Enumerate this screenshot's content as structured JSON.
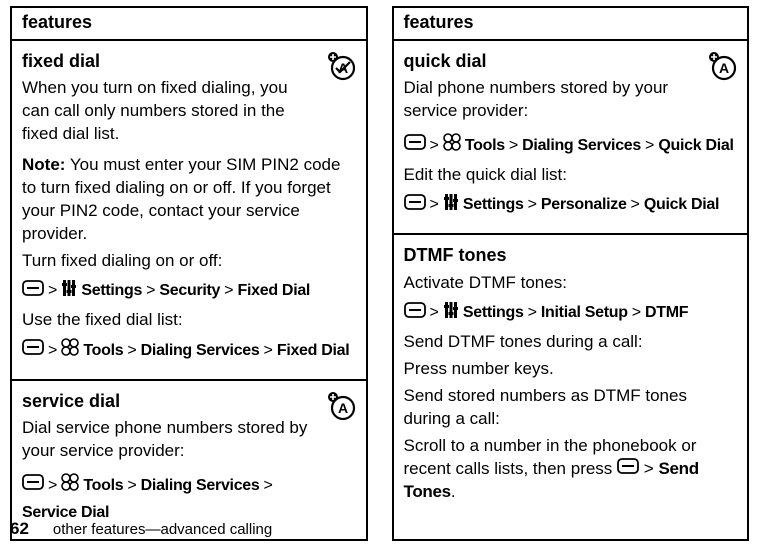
{
  "header": "features",
  "footer": {
    "page": "62",
    "text": "other features—advanced calling"
  },
  "left": {
    "fixed_dial": {
      "title": "fixed dial",
      "p1": "When you turn on fixed dialing, you can call only numbers stored in the fixed dial list.",
      "note_label": "Note:",
      "note_body": " You must enter your SIM PIN2 code to turn fixed dialing on or off. If you forget your PIN2 code, contact your service provider.",
      "p2": "Turn fixed dialing on or off:",
      "path1": {
        "a": "Settings",
        "b": "Security",
        "c": "Fixed Dial"
      },
      "p3": "Use the fixed dial list:",
      "path2": {
        "a": "Tools",
        "b": "Dialing Services",
        "c": "Fixed Dial"
      }
    },
    "service_dial": {
      "title": "service dial",
      "p1": "Dial service phone numbers stored by your service provider:",
      "path1": {
        "a": "Tools",
        "b": "Dialing Services",
        "c": "Service Dial"
      }
    }
  },
  "right": {
    "quick_dial": {
      "title": "quick dial",
      "p1": "Dial phone numbers stored by your service provider:",
      "path1": {
        "a": "Tools",
        "b": "Dialing Services",
        "c": "Quick Dial"
      },
      "p2": "Edit the quick dial list:",
      "path2": {
        "a": "Settings",
        "b": "Personalize",
        "c": "Quick Dial"
      }
    },
    "dtmf": {
      "title": "DTMF tones",
      "p1": "Activate DTMF tones:",
      "path1": {
        "a": "Settings",
        "b": "Initial Setup",
        "c": "DTMF"
      },
      "p2": "Send DTMF tones during a call:",
      "p3": "Press number keys.",
      "p4": "Send stored numbers as DTMF tones during a call:",
      "p5a": "Scroll to a number in the phonebook or recent calls lists, then press ",
      "p5b": "Send Tones",
      "gt": ">"
    }
  }
}
